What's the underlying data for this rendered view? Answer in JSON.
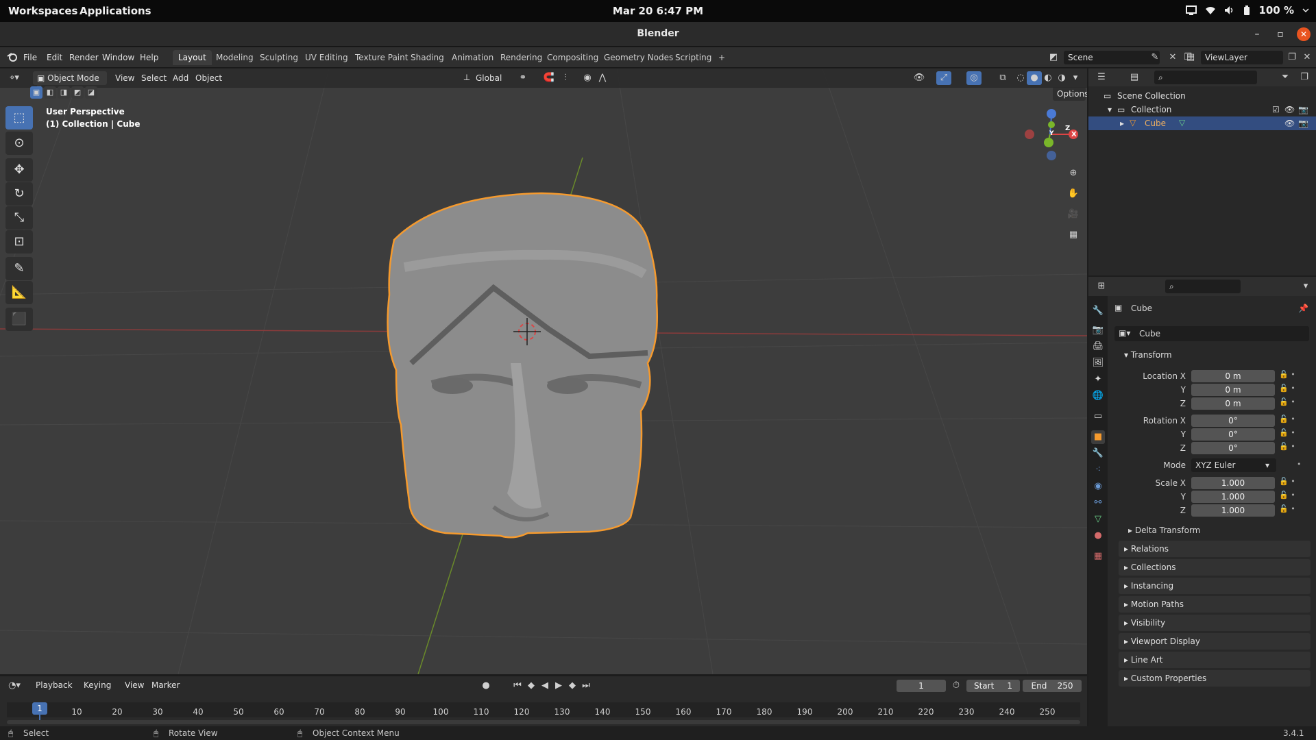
{
  "gnome": {
    "workspaces": "Workspaces",
    "applications": "Applications",
    "clock": "Mar 20  6:47 PM",
    "battery": "100 %"
  },
  "window": {
    "title": "Blender"
  },
  "menu": {
    "file": "File",
    "edit": "Edit",
    "render": "Render",
    "window": "Window",
    "help": "Help",
    "tabs": [
      "Layout",
      "Modeling",
      "Sculpting",
      "UV Editing",
      "Texture Paint",
      "Shading",
      "Animation",
      "Rendering",
      "Compositing",
      "Geometry Nodes",
      "Scripting"
    ],
    "add_tab": "+",
    "scene": "Scene",
    "view_layer": "ViewLayer"
  },
  "viewport": {
    "mode": "Object Mode",
    "view": "View",
    "select": "Select",
    "add": "Add",
    "object": "Object",
    "orientation": "Global",
    "options": "Options",
    "perspective": "User Perspective",
    "collection_info": "(1) Collection | Cube",
    "gizmo_x": "X",
    "gizmo_y": "Y",
    "gizmo_z": "Z"
  },
  "outliner": {
    "scene_collection": "Scene Collection",
    "collection": "Collection",
    "cube": "Cube"
  },
  "properties": {
    "object_name": "Cube",
    "object_field": "Cube",
    "transform": "Transform",
    "location_label": "Location X",
    "rotation_label": "Rotation X",
    "scale_label": "Scale X",
    "y": "Y",
    "z": "Z",
    "loc_x": "0 m",
    "loc_y": "0 m",
    "loc_z": "0 m",
    "rot_x": "0°",
    "rot_y": "0°",
    "rot_z": "0°",
    "mode_label": "Mode",
    "mode_value": "XYZ Euler",
    "scale_x": "1.000",
    "scale_y": "1.000",
    "scale_z": "1.000",
    "delta_transform": "Delta Transform",
    "panels": [
      "Relations",
      "Collections",
      "Instancing",
      "Motion Paths",
      "Visibility",
      "Viewport Display",
      "Line Art",
      "Custom Properties"
    ]
  },
  "timeline": {
    "playback": "Playback",
    "keying": "Keying",
    "view": "View",
    "marker": "Marker",
    "current_frame": "1",
    "start_label": "Start",
    "start_value": "1",
    "end_label": "End",
    "end_value": "250",
    "ticks": [
      "1",
      "10",
      "20",
      "30",
      "40",
      "50",
      "60",
      "70",
      "80",
      "90",
      "100",
      "110",
      "120",
      "130",
      "140",
      "150",
      "160",
      "170",
      "180",
      "190",
      "200",
      "210",
      "220",
      "230",
      "240",
      "250"
    ]
  },
  "status": {
    "select": "Select",
    "rotate_view": "Rotate View",
    "context_menu": "Object Context Menu",
    "version": "3.4.1"
  },
  "colors": {
    "accent": "#4772b3",
    "selection_outline": "#f59a2e",
    "close_button": "#e95420"
  }
}
